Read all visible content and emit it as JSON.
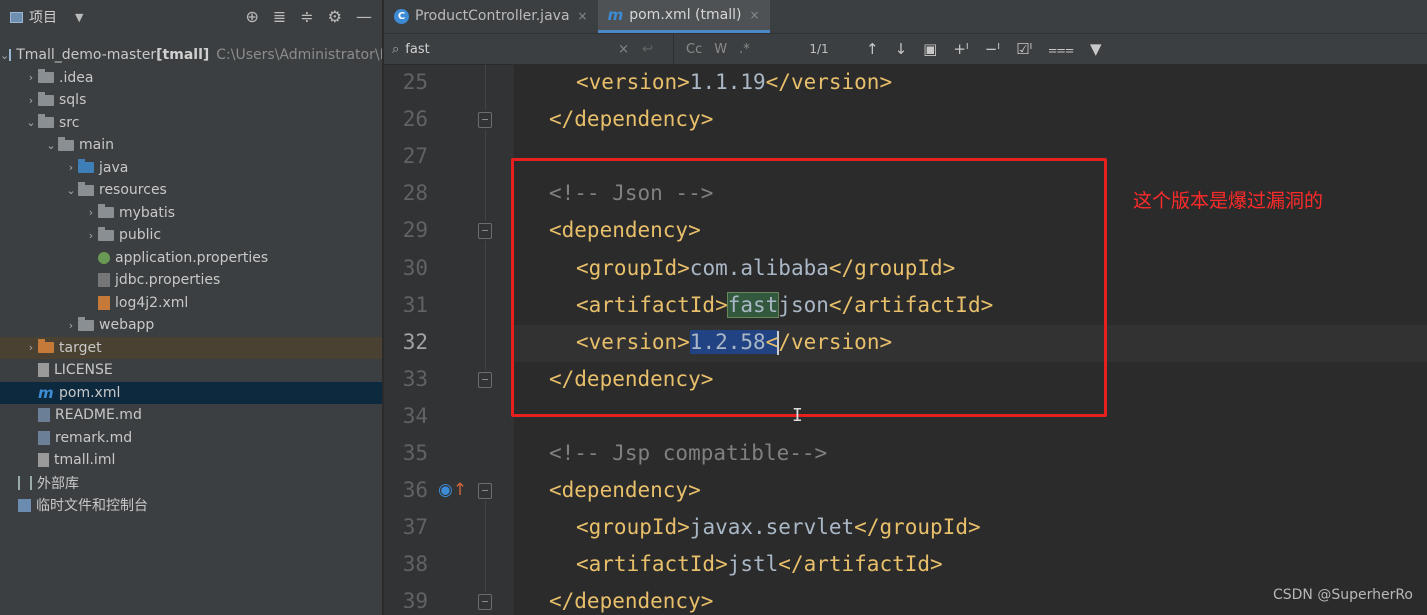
{
  "project_panel": {
    "title": "项目",
    "dropdown_icon": "▼",
    "tools": [
      "target-icon",
      "expand-icon",
      "collapse-icon",
      "gear-icon",
      "minimize-icon"
    ],
    "tools_glyphs": [
      "⊕",
      "≣",
      "≑",
      "⚙",
      "—"
    ],
    "tree": [
      {
        "label": "Tmall_demo-master",
        "bold": "[tmall]",
        "path": "C:\\Users\\Administrator\\De",
        "icon": "module",
        "depth": 0,
        "arrow": "v"
      },
      {
        "label": ".idea",
        "icon": "folder",
        "depth": 1,
        "arrow": ">"
      },
      {
        "label": "sqls",
        "icon": "folder",
        "depth": 1,
        "arrow": ">"
      },
      {
        "label": "src",
        "icon": "folder",
        "depth": 1,
        "arrow": "v"
      },
      {
        "label": "main",
        "icon": "folder",
        "depth": 2,
        "arrow": "v"
      },
      {
        "label": "java",
        "icon": "folder-blue",
        "depth": 3,
        "arrow": ">"
      },
      {
        "label": "resources",
        "icon": "folder",
        "depth": 3,
        "arrow": "v"
      },
      {
        "label": "mybatis",
        "icon": "folder",
        "depth": 4,
        "arrow": ">"
      },
      {
        "label": "public",
        "icon": "folder",
        "depth": 4,
        "arrow": ">"
      },
      {
        "label": "application.properties",
        "icon": "spring",
        "depth": 4,
        "arrow": ""
      },
      {
        "label": "jdbc.properties",
        "icon": "prop",
        "depth": 4,
        "arrow": ""
      },
      {
        "label": "log4j2.xml",
        "icon": "xml",
        "depth": 4,
        "arrow": ""
      },
      {
        "label": "webapp",
        "icon": "folder",
        "depth": 3,
        "arrow": ">"
      },
      {
        "label": "target",
        "icon": "folder-orange",
        "depth": 1,
        "arrow": ">",
        "state": "highlight"
      },
      {
        "label": "LICENSE",
        "icon": "file",
        "depth": 1,
        "arrow": ""
      },
      {
        "label": "pom.xml",
        "icon": "mvn",
        "depth": 1,
        "arrow": "",
        "state": "selected"
      },
      {
        "label": "README.md",
        "icon": "md",
        "depth": 1,
        "arrow": ""
      },
      {
        "label": "remark.md",
        "icon": "md",
        "depth": 1,
        "arrow": ""
      },
      {
        "label": "tmall.iml",
        "icon": "file",
        "depth": 1,
        "arrow": ""
      },
      {
        "label": "外部库",
        "icon": "lib",
        "depth": 0,
        "arrow": ""
      },
      {
        "label": "临时文件和控制台",
        "icon": "scratch",
        "depth": 0,
        "arrow": ""
      }
    ]
  },
  "tabs": [
    {
      "label": "ProductController.java",
      "icon": "C",
      "active": false,
      "close": "×"
    },
    {
      "label": "pom.xml (tmall)",
      "icon": "m",
      "active": true,
      "close": "×"
    }
  ],
  "find_bar": {
    "search_icon": "⌕",
    "query": "fast",
    "clear_icon": "×",
    "regex_icon": "↩",
    "options": [
      "Cc",
      "W",
      ".*"
    ],
    "count": "1/1",
    "tools": [
      "↑",
      "↓",
      "▣",
      "+ᴵ",
      "−ᴵ",
      "☑ᴵ",
      "⩶",
      "▼"
    ]
  },
  "editor": {
    "lines": [
      {
        "no": "25",
        "indent": 1,
        "parts": [
          [
            "tag",
            "<version>"
          ],
          [
            "txt",
            "1.1.19"
          ],
          [
            "tag",
            "</version>"
          ]
        ]
      },
      {
        "no": "26",
        "indent": 0,
        "parts": [
          [
            "tag",
            "</dependency>"
          ]
        ],
        "fold": true
      },
      {
        "no": "27",
        "indent": 0,
        "parts": []
      },
      {
        "no": "28",
        "indent": 0,
        "parts": [
          [
            "cmt",
            "<!-- Json -->"
          ]
        ]
      },
      {
        "no": "29",
        "indent": 0,
        "parts": [
          [
            "tag",
            "<dependency>"
          ]
        ],
        "fold": true
      },
      {
        "no": "30",
        "indent": 1,
        "parts": [
          [
            "tag",
            "<groupId>"
          ],
          [
            "txt",
            "com.alibaba"
          ],
          [
            "tag",
            "</groupId>"
          ]
        ]
      },
      {
        "no": "31",
        "indent": 1,
        "parts": [
          [
            "tag",
            "<artifactId>"
          ],
          [
            "match",
            "fast"
          ],
          [
            "txt",
            "json"
          ],
          [
            "tag",
            "</artifactId>"
          ]
        ]
      },
      {
        "no": "32",
        "indent": 1,
        "parts": [
          [
            "tag",
            "<version>"
          ],
          [
            "sel",
            "1.2.58"
          ],
          [
            "selTag",
            "<"
          ],
          [
            "caret",
            ""
          ],
          [
            "tag",
            "/version>"
          ]
        ],
        "current": true
      },
      {
        "no": "33",
        "indent": 0,
        "parts": [
          [
            "tag",
            "</dependency>"
          ]
        ],
        "fold": true
      },
      {
        "no": "34",
        "indent": 0,
        "parts": []
      },
      {
        "no": "35",
        "indent": 0,
        "parts": [
          [
            "cmt",
            "<!-- Jsp compatible-->"
          ]
        ]
      },
      {
        "no": "36",
        "indent": 0,
        "parts": [
          [
            "tag",
            "<dependency>"
          ]
        ],
        "fold": true,
        "gutter_icon": true
      },
      {
        "no": "37",
        "indent": 1,
        "parts": [
          [
            "tag",
            "<groupId>"
          ],
          [
            "txt",
            "javax.servlet"
          ],
          [
            "tag",
            "</groupId>"
          ]
        ]
      },
      {
        "no": "38",
        "indent": 1,
        "parts": [
          [
            "tag",
            "<artifactId>"
          ],
          [
            "txt",
            "jstl"
          ],
          [
            "tag",
            "</artifactId>"
          ]
        ]
      },
      {
        "no": "39",
        "indent": 0,
        "parts": [
          [
            "tag",
            "</dependency>"
          ]
        ],
        "fold": true
      }
    ],
    "gutter_icon_glyphs": [
      "◉",
      "↑"
    ]
  },
  "annotation": "这个版本是爆过漏洞的",
  "mouse_cursor": "I",
  "watermark": "CSDN @SuperherRo",
  "colors": {
    "annotation_red": "#e81f1f",
    "tag": "#e8bf6a",
    "comment": "#808080",
    "text": "#a9b7c6",
    "selection": "#214283",
    "match": "#32593d"
  }
}
